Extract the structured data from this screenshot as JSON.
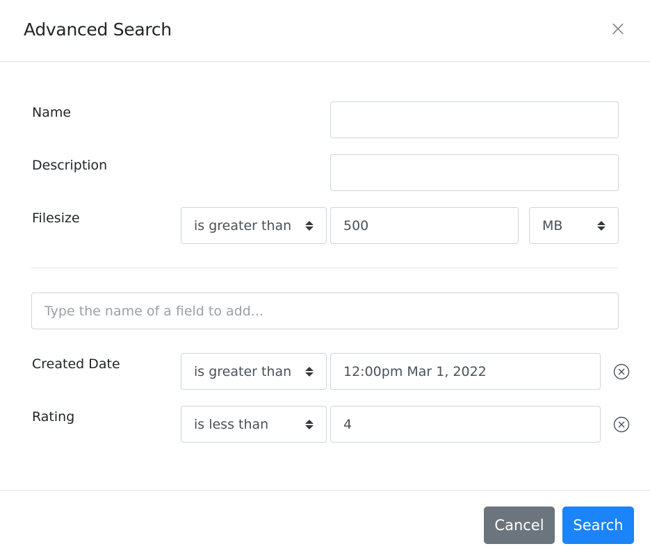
{
  "dialog": {
    "title": "Advanced Search",
    "close_icon": "close-icon"
  },
  "fields": {
    "name": {
      "label": "Name",
      "value": ""
    },
    "description": {
      "label": "Description",
      "value": ""
    },
    "filesize": {
      "label": "Filesize",
      "operator": "is greater than",
      "value": "500",
      "unit": "MB"
    }
  },
  "add_field": {
    "placeholder": "Type the name of a field to add..."
  },
  "added_fields": [
    {
      "label": "Created Date",
      "operator": "is greater than",
      "value": "12:00pm Mar 1, 2022",
      "remove_icon": "circle-x-icon"
    },
    {
      "label": "Rating",
      "operator": "is less than",
      "value": "4",
      "remove_icon": "circle-x-icon"
    }
  ],
  "footer": {
    "cancel_label": "Cancel",
    "search_label": "Search"
  },
  "colors": {
    "primary": "#1a84f8",
    "secondary": "#6c757d",
    "border": "#ced4da"
  }
}
